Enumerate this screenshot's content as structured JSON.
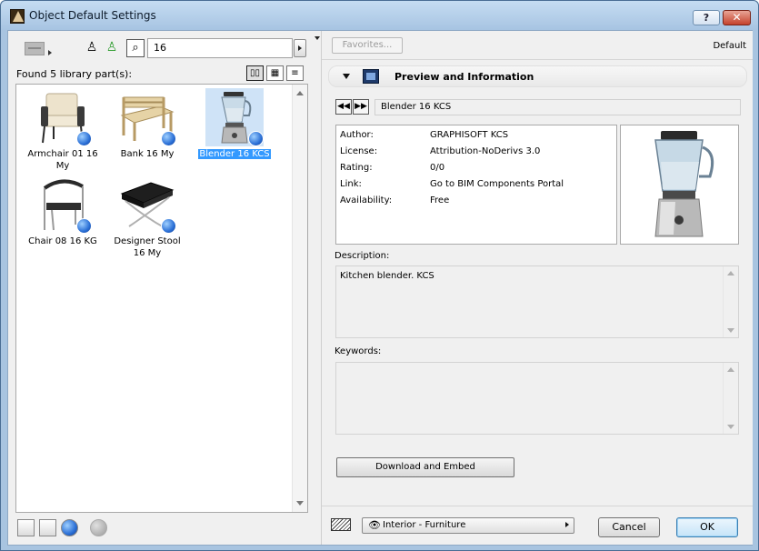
{
  "window": {
    "title": "Object Default Settings",
    "help_label": "?",
    "close_label": "✕"
  },
  "left": {
    "search_value": "16",
    "found_label": "Found 5 library part(s):",
    "items": [
      {
        "caption": "Armchair 01 16 My",
        "icon": "armchair-thumbnail"
      },
      {
        "caption": "Bank 16 My",
        "icon": "bench-thumbnail"
      },
      {
        "caption": "Blender 16 KCS",
        "icon": "blender-thumbnail",
        "selected": true
      },
      {
        "caption": "Chair 08 16 KG",
        "icon": "chair-thumbnail"
      },
      {
        "caption": "Designer Stool 16 My",
        "icon": "stool-thumbnail"
      }
    ]
  },
  "right": {
    "favorites_label": "Favorites...",
    "default_label": "Default",
    "section_title": "Preview and Information",
    "part_name": "Blender 16 KCS",
    "info": [
      {
        "key": "Author:",
        "value": "GRAPHISOFT KCS"
      },
      {
        "key": "License:",
        "value": "Attribution-NoDerivs 3.0"
      },
      {
        "key": "Rating:",
        "value": "0/0"
      },
      {
        "key": "Link:",
        "value": "Go to BIM Components Portal"
      },
      {
        "key": "Availability:",
        "value": "Free"
      }
    ],
    "description_label": "Description:",
    "description_text": "Kitchen blender. KCS",
    "keywords_label": "Keywords:",
    "keywords_text": "",
    "download_label": "Download and Embed"
  },
  "footer": {
    "layer_value": "Interior - Furniture",
    "cancel_label": "Cancel",
    "ok_label": "OK"
  },
  "colors": {
    "selection": "#3399ff",
    "globe": "#2a6fd6",
    "title_bar": "#a7c4e2"
  }
}
